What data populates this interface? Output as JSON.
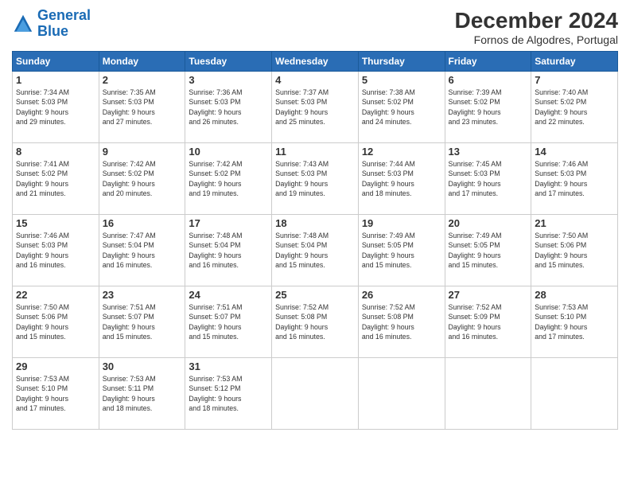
{
  "logo": {
    "line1": "General",
    "line2": "Blue"
  },
  "title": "December 2024",
  "subtitle": "Fornos de Algodres, Portugal",
  "days_of_week": [
    "Sunday",
    "Monday",
    "Tuesday",
    "Wednesday",
    "Thursday",
    "Friday",
    "Saturday"
  ],
  "weeks": [
    [
      {
        "day": "1",
        "sunrise": "7:34 AM",
        "sunset": "5:03 PM",
        "daylight": "9 hours and 29 minutes."
      },
      {
        "day": "2",
        "sunrise": "7:35 AM",
        "sunset": "5:03 PM",
        "daylight": "9 hours and 27 minutes."
      },
      {
        "day": "3",
        "sunrise": "7:36 AM",
        "sunset": "5:03 PM",
        "daylight": "9 hours and 26 minutes."
      },
      {
        "day": "4",
        "sunrise": "7:37 AM",
        "sunset": "5:03 PM",
        "daylight": "9 hours and 25 minutes."
      },
      {
        "day": "5",
        "sunrise": "7:38 AM",
        "sunset": "5:02 PM",
        "daylight": "9 hours and 24 minutes."
      },
      {
        "day": "6",
        "sunrise": "7:39 AM",
        "sunset": "5:02 PM",
        "daylight": "9 hours and 23 minutes."
      },
      {
        "day": "7",
        "sunrise": "7:40 AM",
        "sunset": "5:02 PM",
        "daylight": "9 hours and 22 minutes."
      }
    ],
    [
      {
        "day": "8",
        "sunrise": "7:41 AM",
        "sunset": "5:02 PM",
        "daylight": "9 hours and 21 minutes."
      },
      {
        "day": "9",
        "sunrise": "7:42 AM",
        "sunset": "5:02 PM",
        "daylight": "9 hours and 20 minutes."
      },
      {
        "day": "10",
        "sunrise": "7:42 AM",
        "sunset": "5:02 PM",
        "daylight": "9 hours and 19 minutes."
      },
      {
        "day": "11",
        "sunrise": "7:43 AM",
        "sunset": "5:03 PM",
        "daylight": "9 hours and 19 minutes."
      },
      {
        "day": "12",
        "sunrise": "7:44 AM",
        "sunset": "5:03 PM",
        "daylight": "9 hours and 18 minutes."
      },
      {
        "day": "13",
        "sunrise": "7:45 AM",
        "sunset": "5:03 PM",
        "daylight": "9 hours and 17 minutes."
      },
      {
        "day": "14",
        "sunrise": "7:46 AM",
        "sunset": "5:03 PM",
        "daylight": "9 hours and 17 minutes."
      }
    ],
    [
      {
        "day": "15",
        "sunrise": "7:46 AM",
        "sunset": "5:03 PM",
        "daylight": "9 hours and 16 minutes."
      },
      {
        "day": "16",
        "sunrise": "7:47 AM",
        "sunset": "5:04 PM",
        "daylight": "9 hours and 16 minutes."
      },
      {
        "day": "17",
        "sunrise": "7:48 AM",
        "sunset": "5:04 PM",
        "daylight": "9 hours and 16 minutes."
      },
      {
        "day": "18",
        "sunrise": "7:48 AM",
        "sunset": "5:04 PM",
        "daylight": "9 hours and 15 minutes."
      },
      {
        "day": "19",
        "sunrise": "7:49 AM",
        "sunset": "5:05 PM",
        "daylight": "9 hours and 15 minutes."
      },
      {
        "day": "20",
        "sunrise": "7:49 AM",
        "sunset": "5:05 PM",
        "daylight": "9 hours and 15 minutes."
      },
      {
        "day": "21",
        "sunrise": "7:50 AM",
        "sunset": "5:06 PM",
        "daylight": "9 hours and 15 minutes."
      }
    ],
    [
      {
        "day": "22",
        "sunrise": "7:50 AM",
        "sunset": "5:06 PM",
        "daylight": "9 hours and 15 minutes."
      },
      {
        "day": "23",
        "sunrise": "7:51 AM",
        "sunset": "5:07 PM",
        "daylight": "9 hours and 15 minutes."
      },
      {
        "day": "24",
        "sunrise": "7:51 AM",
        "sunset": "5:07 PM",
        "daylight": "9 hours and 15 minutes."
      },
      {
        "day": "25",
        "sunrise": "7:52 AM",
        "sunset": "5:08 PM",
        "daylight": "9 hours and 16 minutes."
      },
      {
        "day": "26",
        "sunrise": "7:52 AM",
        "sunset": "5:08 PM",
        "daylight": "9 hours and 16 minutes."
      },
      {
        "day": "27",
        "sunrise": "7:52 AM",
        "sunset": "5:09 PM",
        "daylight": "9 hours and 16 minutes."
      },
      {
        "day": "28",
        "sunrise": "7:53 AM",
        "sunset": "5:10 PM",
        "daylight": "9 hours and 17 minutes."
      }
    ],
    [
      {
        "day": "29",
        "sunrise": "7:53 AM",
        "sunset": "5:10 PM",
        "daylight": "9 hours and 17 minutes."
      },
      {
        "day": "30",
        "sunrise": "7:53 AM",
        "sunset": "5:11 PM",
        "daylight": "9 hours and 18 minutes."
      },
      {
        "day": "31",
        "sunrise": "7:53 AM",
        "sunset": "5:12 PM",
        "daylight": "9 hours and 18 minutes."
      },
      null,
      null,
      null,
      null
    ]
  ]
}
